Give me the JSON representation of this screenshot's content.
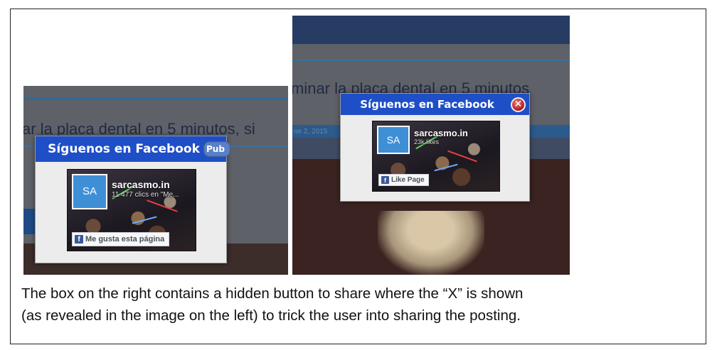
{
  "left_screenshot": {
    "headline_fragment": "ar la placa dental en 5 minutos, si",
    "popup": {
      "title": "Síguenos en Facebook",
      "hidden_button_label": "Pub",
      "fb_widget": {
        "page_name": "sarcasmo.in",
        "avatar_text": "SA",
        "count_text": "11 477 clics en \"Me...",
        "like_button_label": "Me gusta esta página"
      }
    }
  },
  "right_screenshot": {
    "headline_fragment": "minar la placa dental en 5 minutos",
    "date_fragment": "ne 2, 2015",
    "popup": {
      "title": "Síguenos en Facebook",
      "close_glyph": "✕",
      "fb_widget": {
        "page_name": "sarcasmo.in",
        "avatar_text": "SA",
        "count_text": "23k likes",
        "like_button_label": "Like Page"
      }
    }
  },
  "caption": {
    "line1": "The box on the right contains a hidden button to share where the “X” is shown",
    "line2": "(as revealed in the image on the left) to trick the user into sharing the posting."
  },
  "colors": {
    "popup_header": "#1f4fc7",
    "facebook_blue": "#3b5998",
    "close_button": "#c0392b"
  }
}
